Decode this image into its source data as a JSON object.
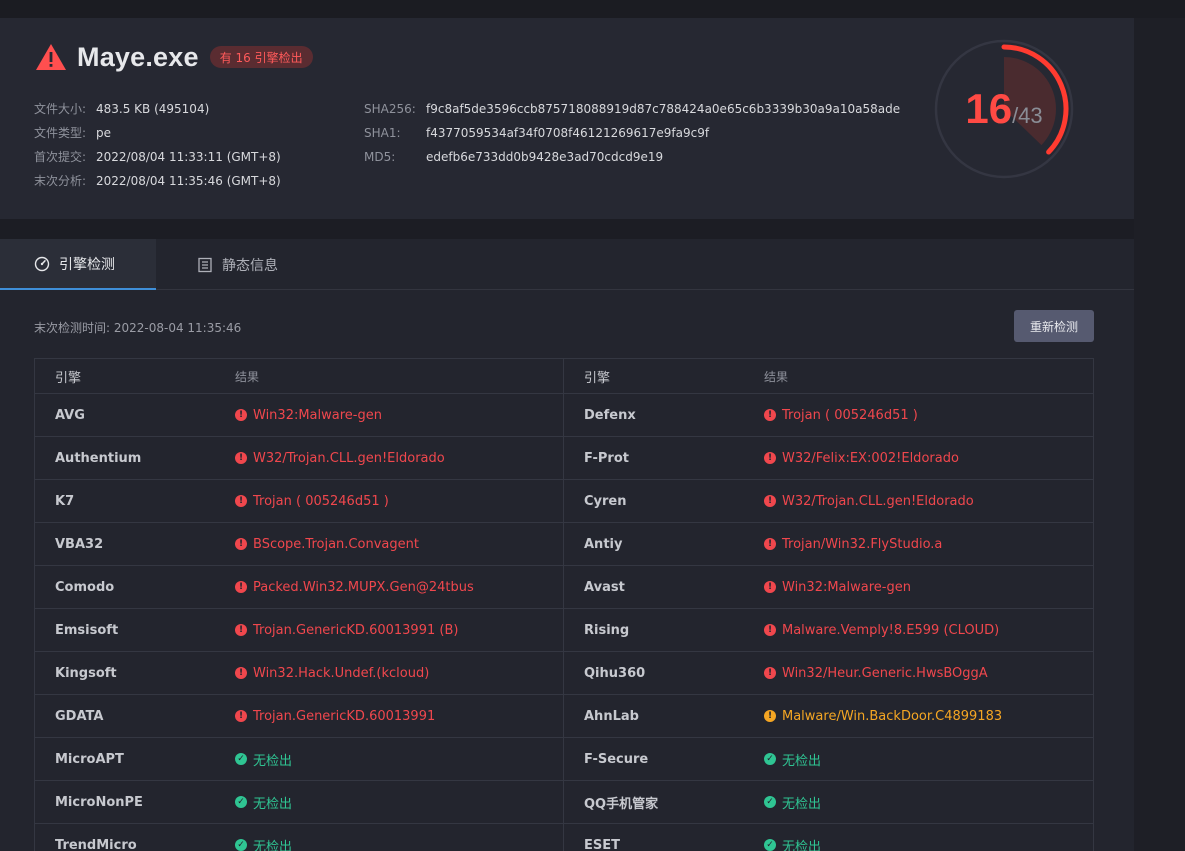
{
  "file": {
    "name": "Maye.exe",
    "badge": "有 16 引擎检出",
    "size_label": "文件大小:",
    "size": "483.5 KB (495104)",
    "type_label": "文件类型:",
    "type": "pe",
    "first_submit_label": "首次提交:",
    "first_submit": "2022/08/04 11:33:11 (GMT+8)",
    "last_analysis_label": "末次分析:",
    "last_analysis": "2022/08/04 11:35:46 (GMT+8)",
    "sha256_label": "SHA256:",
    "sha256": "f9c8af5de3596ccb875718088919d87c788424a0e65c6b3339b30a9a10a58ade",
    "sha1_label": "SHA1:",
    "sha1": "f4377059534af34f0708f46121269617e9fa9c9f",
    "md5_label": "MD5:",
    "md5": "edefb6e733dd0b9428e3ad70cdcd9e19"
  },
  "score": {
    "detected": "16",
    "total": "/43",
    "detected_value": 16,
    "total_value": 43
  },
  "tabs": [
    {
      "label": "引擎检测"
    },
    {
      "label": "静态信息"
    }
  ],
  "detection": {
    "last_check": "末次检测时间: 2022-08-04 11:35:46",
    "recheck_label": "重新检测",
    "col_engine": "引擎",
    "col_result": "结果",
    "rows": [
      {
        "l_eng": "AVG",
        "l_res": "Win32:Malware-gen",
        "l_status": "bad",
        "r_eng": "Defenx",
        "r_res": "Trojan ( 005246d51 )",
        "r_status": "bad"
      },
      {
        "l_eng": "Authentium",
        "l_res": "W32/Trojan.CLL.gen!Eldorado",
        "l_status": "bad",
        "r_eng": "F-Prot",
        "r_res": "W32/Felix:EX:002!Eldorado",
        "r_status": "bad"
      },
      {
        "l_eng": "K7",
        "l_res": "Trojan ( 005246d51 )",
        "l_status": "bad",
        "r_eng": "Cyren",
        "r_res": "W32/Trojan.CLL.gen!Eldorado",
        "r_status": "bad"
      },
      {
        "l_eng": "VBA32",
        "l_res": "BScope.Trojan.Convagent",
        "l_status": "bad",
        "r_eng": "Antiy",
        "r_res": "Trojan/Win32.FlyStudio.a",
        "r_status": "bad"
      },
      {
        "l_eng": "Comodo",
        "l_res": "Packed.Win32.MUPX.Gen@24tbus",
        "l_status": "bad",
        "r_eng": "Avast",
        "r_res": "Win32:Malware-gen",
        "r_status": "bad"
      },
      {
        "l_eng": "Emsisoft",
        "l_res": "Trojan.GenericKD.60013991 (B)",
        "l_status": "bad",
        "r_eng": "Rising",
        "r_res": "Malware.Vemply!8.E599 (CLOUD)",
        "r_status": "bad"
      },
      {
        "l_eng": "Kingsoft",
        "l_res": "Win32.Hack.Undef.(kcloud)",
        "l_status": "bad",
        "r_eng": "Qihu360",
        "r_res": "Win32/Heur.Generic.HwsBOggA",
        "r_status": "bad"
      },
      {
        "l_eng": "GDATA",
        "l_res": "Trojan.GenericKD.60013991",
        "l_status": "bad",
        "r_eng": "AhnLab",
        "r_res": "Malware/Win.BackDoor.C4899183",
        "r_status": "warn"
      },
      {
        "l_eng": "MicroAPT",
        "l_res": "无检出",
        "l_status": "ok",
        "r_eng": "F-Secure",
        "r_res": "无检出",
        "r_status": "ok"
      },
      {
        "l_eng": "MicroNonPE",
        "l_res": "无检出",
        "l_status": "ok",
        "r_eng": "QQ手机管家",
        "r_res": "无检出",
        "r_status": "ok"
      },
      {
        "l_eng": "TrendMicro",
        "l_res": "无检出",
        "l_status": "ok",
        "r_eng": "ESET",
        "r_res": "无检出",
        "r_status": "ok"
      }
    ]
  },
  "colors": {
    "bad": "#f0474d",
    "warn": "#f5a623",
    "ok": "#2fc593",
    "accent": "#3f8fd8"
  },
  "icons": {
    "title": "warning-triangle-icon",
    "tab1": "speedometer-icon",
    "tab2": "document-list-icon",
    "bad": "exclamation-circle-icon",
    "ok": "check-circle-icon"
  }
}
